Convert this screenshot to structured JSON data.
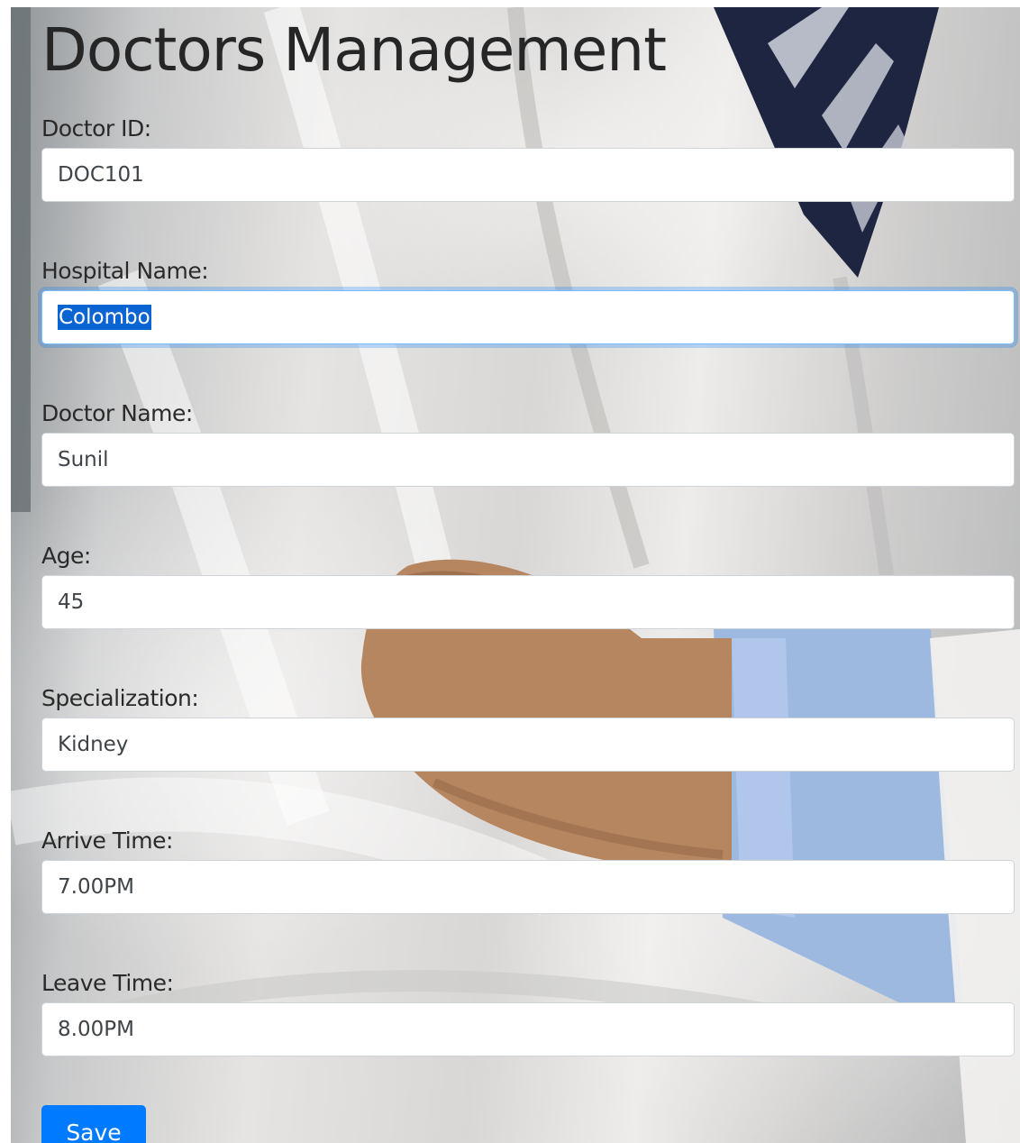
{
  "header": {
    "title": "Doctors Management"
  },
  "form": {
    "fields": [
      {
        "label": "Doctor ID:",
        "value": "DOC101"
      },
      {
        "label": "Hospital Name:",
        "value": "Colombo",
        "focused": true,
        "text_selected": true
      },
      {
        "label": "Doctor Name:",
        "value": "Sunil"
      },
      {
        "label": "Age:",
        "value": "45"
      },
      {
        "label": "Specialization:",
        "value": "Kidney"
      },
      {
        "label": "Arrive Time:",
        "value": "7.00PM"
      },
      {
        "label": "Leave Time:",
        "value": "8.00PM"
      }
    ],
    "save_label": "Save"
  },
  "colors": {
    "primary": "#007bff",
    "focus_ring": "#80bdff",
    "selection": "#0a64d2"
  }
}
